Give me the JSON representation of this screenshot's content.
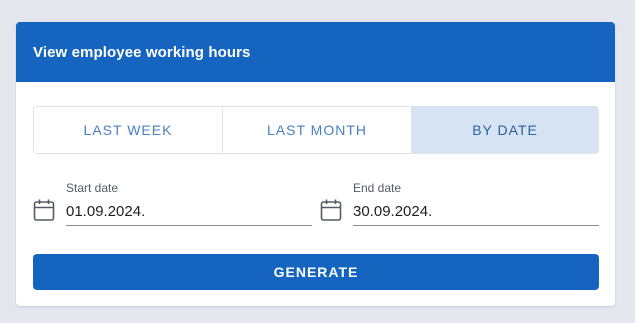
{
  "card": {
    "title": "View employee working hours"
  },
  "tabs": [
    {
      "label": "LAST WEEK",
      "active": false
    },
    {
      "label": "LAST MONTH",
      "active": false
    },
    {
      "label": "BY DATE",
      "active": true
    }
  ],
  "start_date": {
    "label": "Start date",
    "value": "01.09.2024.",
    "icon": "calendar-icon"
  },
  "end_date": {
    "label": "End date",
    "value": "30.09.2024.",
    "icon": "calendar-icon"
  },
  "generate_label": "GENERATE",
  "colors": {
    "primary": "#1565c0",
    "tab_active_bg": "#d6e3f3",
    "tab_text": "#4a7fc0",
    "page_bg": "#e4e7ee"
  }
}
